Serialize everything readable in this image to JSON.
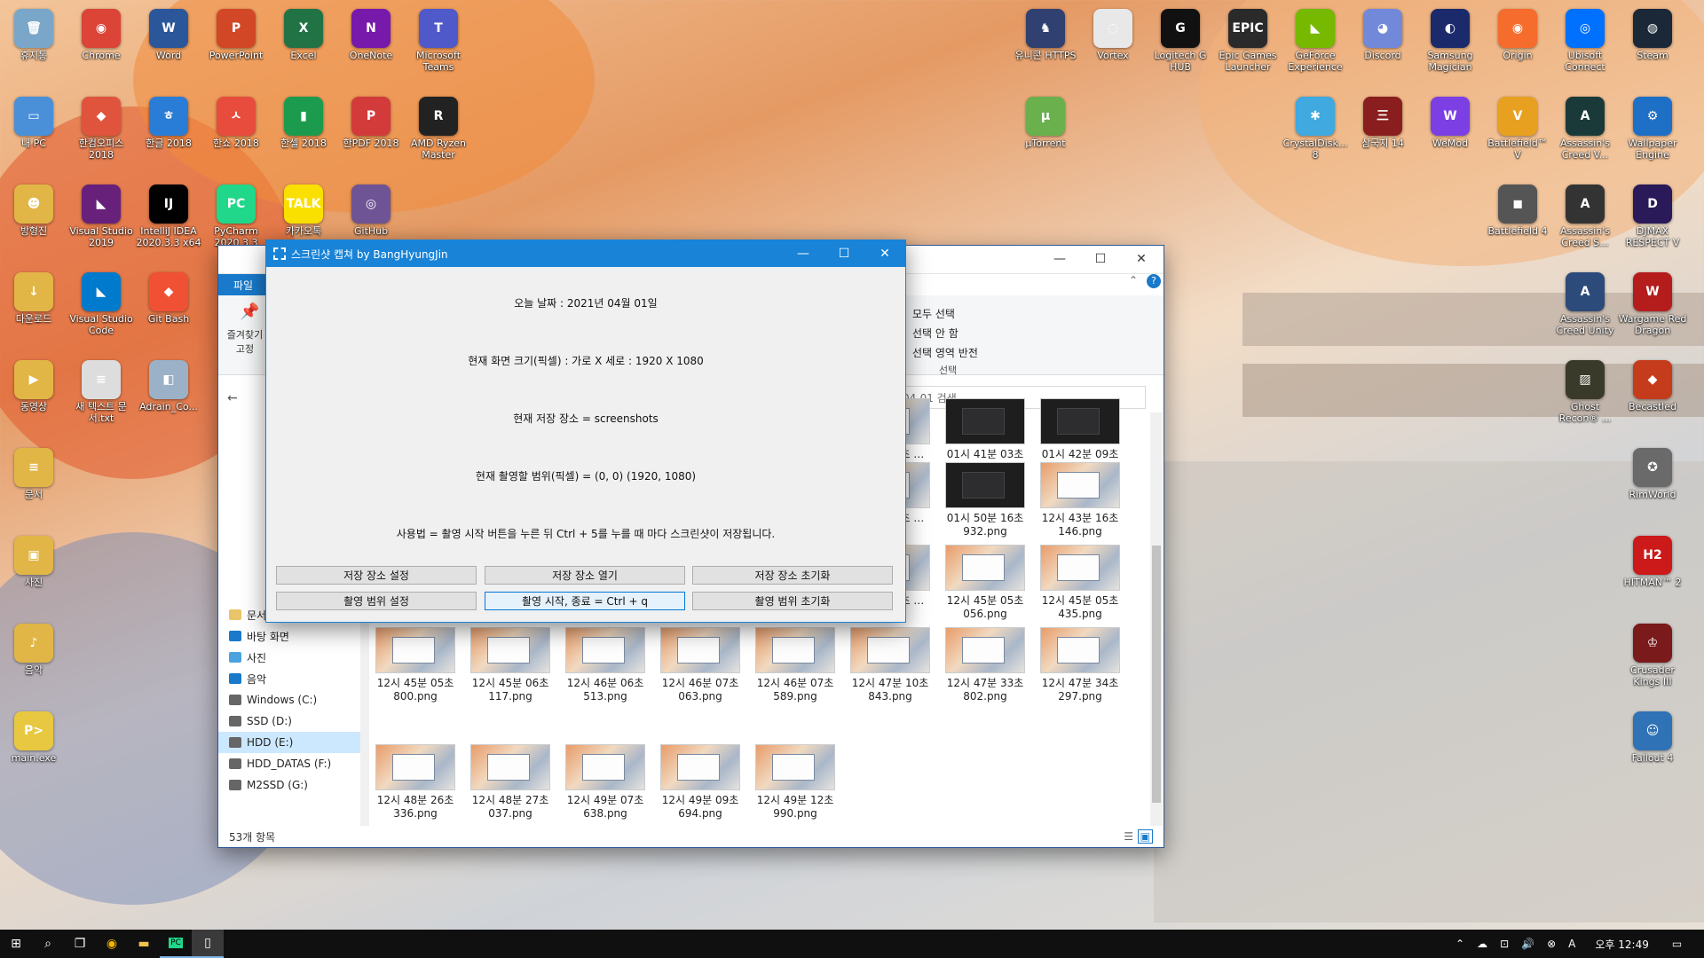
{
  "desktop": {
    "left_icons": [
      {
        "label": "휴지통",
        "glyph": "🗑",
        "color": "#7aa7c9"
      },
      {
        "label": "Chrome",
        "glyph": "◉",
        "color": "#db4437"
      },
      {
        "label": "Word",
        "glyph": "W",
        "color": "#2b579a"
      },
      {
        "label": "PowerPoint",
        "glyph": "P",
        "color": "#d24726"
      },
      {
        "label": "Excel",
        "glyph": "X",
        "color": "#217346"
      },
      {
        "label": "OneNote",
        "glyph": "N",
        "color": "#7719aa"
      },
      {
        "label": "Microsoft Teams",
        "glyph": "T",
        "color": "#5059c9"
      },
      {
        "label": "내 PC",
        "glyph": "▭",
        "color": "#4a90d9"
      },
      {
        "label": "한컴오피스 2018",
        "glyph": "◆",
        "color": "#e0533d"
      },
      {
        "label": "한글 2018",
        "glyph": "ㅎ",
        "color": "#2a7dd6"
      },
      {
        "label": "한쇼 2018",
        "glyph": "ㅅ",
        "color": "#e84c3d"
      },
      {
        "label": "한셀 2018",
        "glyph": "▮",
        "color": "#1c9b4e"
      },
      {
        "label": "한PDF 2018",
        "glyph": "P",
        "color": "#d33b3b"
      },
      {
        "label": "AMD Ryzen Master",
        "glyph": "R",
        "color": "#222222"
      },
      {
        "label": "방형진",
        "glyph": "☻",
        "color": "#e2b646"
      },
      {
        "label": "Visual Studio 2019",
        "glyph": "◣",
        "color": "#68217a"
      },
      {
        "label": "IntelliJ IDEA 2020.3.3 x64",
        "glyph": "IJ",
        "color": "#000000"
      },
      {
        "label": "PyCharm 2020.3.3",
        "glyph": "PC",
        "color": "#21d789"
      },
      {
        "label": "카카오톡",
        "glyph": "TALK",
        "color": "#f9e000"
      },
      {
        "label": "GitHub",
        "glyph": "◎",
        "color": "#6e5494"
      },
      {
        "label": "다운로드",
        "glyph": "↓",
        "color": "#e2b646"
      },
      {
        "label": "Visual Studio Code",
        "glyph": "◣",
        "color": "#007acc"
      },
      {
        "label": "Git Bash",
        "glyph": "◆",
        "color": "#f05033"
      },
      {
        "label": "동영상",
        "glyph": "▶",
        "color": "#e2b646"
      },
      {
        "label": "새 텍스트 문서.txt",
        "glyph": "≡",
        "color": "#dddddd"
      },
      {
        "label": "Adrain_Co...",
        "glyph": "◧",
        "color": "#9ab1c8"
      },
      {
        "label": "문서",
        "glyph": "≡",
        "color": "#e2b646"
      },
      {
        "label": "사진",
        "glyph": "▣",
        "color": "#e2b646"
      },
      {
        "label": "음악",
        "glyph": "♪",
        "color": "#e2b646"
      },
      {
        "label": "main.exe",
        "glyph": "P>",
        "color": "#e8c840"
      }
    ],
    "right_icons": [
      {
        "label": "유니콘 HTTPS",
        "glyph": "♞",
        "color": "#304070"
      },
      {
        "label": "Vortex",
        "glyph": "◌",
        "color": "#e8e8e8"
      },
      {
        "label": "Logitech G HUB",
        "glyph": "G",
        "color": "#111111"
      },
      {
        "label": "Epic Games Launcher",
        "glyph": "EPIC",
        "color": "#2a2a2a"
      },
      {
        "label": "GeForce Experience",
        "glyph": "◣",
        "color": "#76b900"
      },
      {
        "label": "Discord",
        "glyph": "◕",
        "color": "#7289da"
      },
      {
        "label": "Samsung Magician",
        "glyph": "◐",
        "color": "#1b2a6b"
      },
      {
        "label": "Origin",
        "glyph": "◉",
        "color": "#f56c2d"
      },
      {
        "label": "Ubisoft Connect",
        "glyph": "◎",
        "color": "#0070ff"
      },
      {
        "label": "Steam",
        "glyph": "◍",
        "color": "#1b2838"
      },
      {
        "label": "µTorrent",
        "glyph": "µ",
        "color": "#6ab04c"
      },
      {
        "label": "CrystalDisk... 8",
        "glyph": "✱",
        "color": "#3fa9e0"
      },
      {
        "label": "삼국지 14",
        "glyph": "三",
        "color": "#8a1d1d"
      },
      {
        "label": "WeMod",
        "glyph": "W",
        "color": "#7b3fe4"
      },
      {
        "label": "Battlefield™ V",
        "glyph": "V",
        "color": "#e8a020"
      },
      {
        "label": "Assassin's Creed V...",
        "glyph": "A",
        "color": "#1a3a3a"
      },
      {
        "label": "Wallpaper Engine",
        "glyph": "⚙",
        "color": "#1e6fc6"
      },
      {
        "label": "Battlefield 4",
        "glyph": "◼",
        "color": "#555555"
      },
      {
        "label": "Assassin's Creed S...",
        "glyph": "A",
        "color": "#333333"
      },
      {
        "label": "DJMAX RESPECT V",
        "glyph": "D",
        "color": "#2a1a5a"
      },
      {
        "label": "Assassin's Creed Unity",
        "glyph": "A",
        "color": "#2c4a7a"
      },
      {
        "label": "Wargame Red Dragon",
        "glyph": "W",
        "color": "#b51c1c"
      },
      {
        "label": "Ghost Recon® ...",
        "glyph": "▨",
        "color": "#3a3a2a"
      },
      {
        "label": "Becastled",
        "glyph": "◆",
        "color": "#c43c1c"
      },
      {
        "label": "RimWorld",
        "glyph": "✪",
        "color": "#6a6a6a"
      },
      {
        "label": "HITMAN™ 2",
        "glyph": "H2",
        "color": "#cc1a1a"
      },
      {
        "label": "Crusader Kings III",
        "glyph": "♔",
        "color": "#7a1a1a"
      },
      {
        "label": "Fallout 4",
        "glyph": "☺",
        "color": "#2f72b6"
      }
    ]
  },
  "explorer": {
    "ribbon_tab": "파일",
    "ribbon_pin_label": "즐겨찾기 고정",
    "select_group": [
      "모두 선택",
      "선택 안 함",
      "선택 영역 반전"
    ],
    "select_group_title": "선택",
    "search_placeholder": "1-04-01 검색",
    "nav_items": [
      "문서",
      "바탕 화면",
      "사진",
      "음악",
      "Windows (C:)",
      "SSD (D:)",
      "HDD (E:)",
      "HDD_DATAS (F:)",
      "M2SSD (G:)"
    ],
    "files_row1": [
      {
        "name": "…1분 03초 …0.png",
        "dark": false
      },
      {
        "name": "01시 41분 03초 326.png",
        "dark": true
      },
      {
        "name": "01시 42분 09초 373.png",
        "dark": true
      }
    ],
    "files_row2": [
      {
        "name": "…3분 57초 …4.png",
        "dark": false
      },
      {
        "name": "01시 50분 16초 932.png",
        "dark": true
      },
      {
        "name": "12시 43분 16초 146.png",
        "dark": false
      }
    ],
    "files_row3": [
      {
        "name": "…5분 04초 …7.png",
        "dark": false
      },
      {
        "name": "12시 45분 05초 056.png",
        "dark": false
      },
      {
        "name": "12시 45분 05초 435.png",
        "dark": false
      }
    ],
    "files_row4": [
      {
        "name": "12시 45분 05초 800.png",
        "dark": false
      },
      {
        "name": "12시 45분 06초 117.png",
        "dark": false
      },
      {
        "name": "12시 46분 06초 513.png",
        "dark": false
      },
      {
        "name": "12시 46분 07초 063.png",
        "dark": false
      },
      {
        "name": "12시 46분 07초 589.png",
        "dark": false
      },
      {
        "name": "12시 47분 10초 843.png",
        "dark": false
      },
      {
        "name": "12시 47분 33초 802.png",
        "dark": false
      },
      {
        "name": "12시 47분 34초 297.png",
        "dark": false
      }
    ],
    "files_row5": [
      {
        "name": "12시 48분 26초 336.png",
        "dark": false
      },
      {
        "name": "12시 48분 27초 037.png",
        "dark": false
      },
      {
        "name": "12시 49분 07초 638.png",
        "dark": false
      },
      {
        "name": "12시 49분 09초 694.png",
        "dark": false
      },
      {
        "name": "12시 49분 12초 990.png",
        "dark": false
      }
    ],
    "status_text": "53개 항목"
  },
  "capture_app": {
    "title": "스크린샷 캡쳐 by BangHyungJin",
    "date_line": "오늘 날짜 : 2021년 04월 01일",
    "size_line": "현재 화면 크기(픽셀) : 가로 X 세로 : 1920 X 1080",
    "save_line": "현재 저장 장소 = screenshots",
    "range_line": "현재 촬영할 범위(픽셀) = (0, 0) (1920, 1080)",
    "usage_line": "사용법 = 촬영 시작 버튼을 누른 뒤 Ctrl + 5를 누를 때 마다 스크린샷이 저장됩니다.",
    "buttons": {
      "set_save": "저장 장소 설정",
      "open_save": "저장 장소 열기",
      "reset_save": "저장 장소 초기화",
      "set_range": "촬영 범위 설정",
      "start_stop": "촬영 시작, 종료 = Ctrl + q",
      "reset_range": "촬영 범위 초기화"
    }
  },
  "taskbar": {
    "time": "오후 12:49",
    "ime": "A"
  }
}
